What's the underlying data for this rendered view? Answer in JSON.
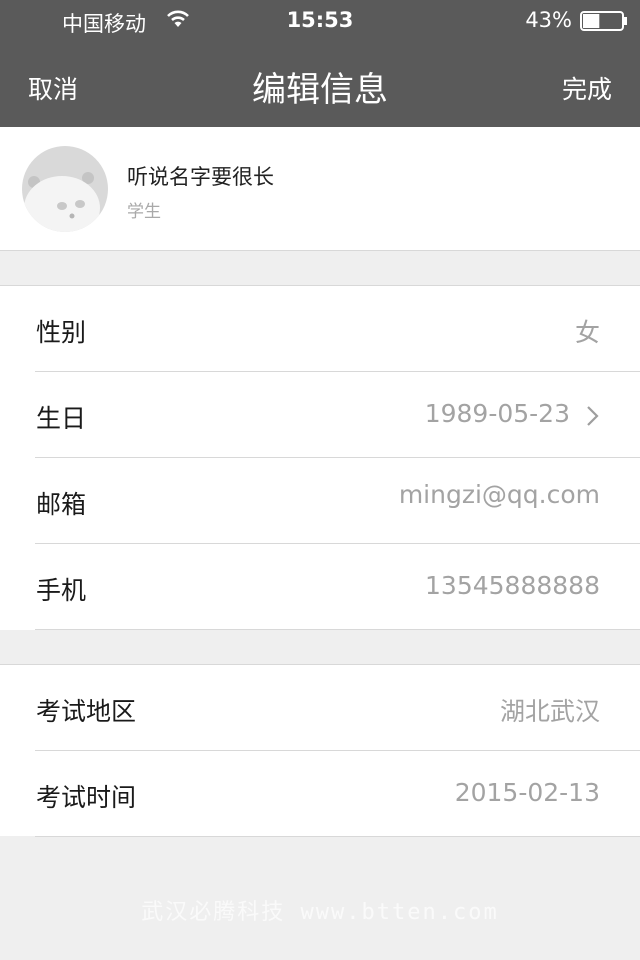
{
  "status_bar": {
    "carrier": "中国移动",
    "time": "15:53",
    "battery_percent": "43%",
    "battery_level": 0.43,
    "wifi_icon": "wifi-icon",
    "battery_icon": "battery-icon"
  },
  "nav": {
    "cancel_label": "取消",
    "title": "编辑信息",
    "done_label": "完成"
  },
  "profile": {
    "name": "听说名字要很长",
    "role": "学生",
    "avatar_icon": "panda-avatar"
  },
  "group1": [
    {
      "label": "性别",
      "value": "女"
    },
    {
      "label": "生日",
      "value": "1989-05-23",
      "has_chevron": true
    },
    {
      "label": "邮箱",
      "value": "mingzi@qq.com"
    },
    {
      "label": "手机",
      "value": "13545888888"
    }
  ],
  "group2": [
    {
      "label": "考试地区",
      "value": "湖北武汉"
    },
    {
      "label": "考试时间",
      "value": "2015-02-13"
    }
  ],
  "watermark": "武汉必腾科技 www.btten.com",
  "colors": {
    "header_bg": "#5a5a5a",
    "page_bg": "#efefef",
    "value_text": "#a3a3a3"
  }
}
